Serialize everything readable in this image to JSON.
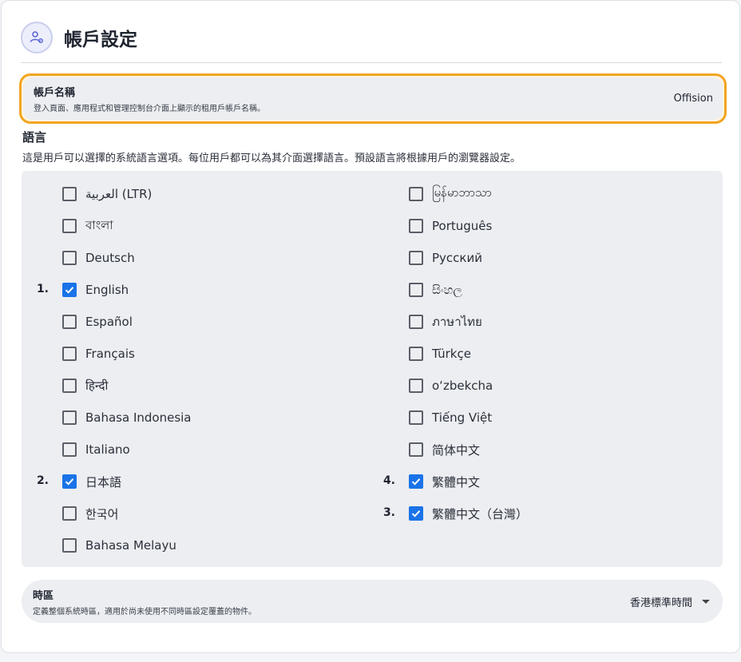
{
  "header": {
    "title": "帳戶設定",
    "icon": "user-gear-icon"
  },
  "account_name": {
    "title": "帳戶名稱",
    "description": "登入頁面、應用程式和管理控制台介面上顯示的租用戶帳戶名稱。",
    "value": "Offision"
  },
  "language": {
    "title": "語言",
    "description": "這是用戶可以選擇的系統語言選項。每位用戶都可以為其介面選擇語言。預設語言將根據用戶的瀏覽器設定。",
    "left": [
      {
        "label": "العربية (LTR)",
        "checked": false,
        "order": ""
      },
      {
        "label": "বাংলা",
        "checked": false,
        "order": ""
      },
      {
        "label": "Deutsch",
        "checked": false,
        "order": ""
      },
      {
        "label": "English",
        "checked": true,
        "order": "1."
      },
      {
        "label": "Español",
        "checked": false,
        "order": ""
      },
      {
        "label": "Français",
        "checked": false,
        "order": ""
      },
      {
        "label": "हिन्दी",
        "checked": false,
        "order": ""
      },
      {
        "label": "Bahasa Indonesia",
        "checked": false,
        "order": ""
      },
      {
        "label": "Italiano",
        "checked": false,
        "order": ""
      },
      {
        "label": "日本語",
        "checked": true,
        "order": "2."
      },
      {
        "label": "한국어",
        "checked": false,
        "order": ""
      },
      {
        "label": "Bahasa Melayu",
        "checked": false,
        "order": ""
      }
    ],
    "right": [
      {
        "label": "မြန်မာဘာသာ",
        "checked": false,
        "order": ""
      },
      {
        "label": "Português",
        "checked": false,
        "order": ""
      },
      {
        "label": "Русский",
        "checked": false,
        "order": ""
      },
      {
        "label": "සිංහල",
        "checked": false,
        "order": ""
      },
      {
        "label": "ภาษาไทย",
        "checked": false,
        "order": ""
      },
      {
        "label": "Türkçe",
        "checked": false,
        "order": ""
      },
      {
        "label": "oʻzbekcha",
        "checked": false,
        "order": ""
      },
      {
        "label": "Tiếng Việt",
        "checked": false,
        "order": ""
      },
      {
        "label": "简体中文",
        "checked": false,
        "order": ""
      },
      {
        "label": "繁體中文",
        "checked": true,
        "order": "4."
      },
      {
        "label": "繁體中文（台灣）",
        "checked": true,
        "order": "3."
      }
    ]
  },
  "timezone": {
    "title": "時區",
    "description": "定義整個系統時區，適用於尚未使用不同時區設定覆蓋的物件。",
    "value": "香港標準時間",
    "dropdown_icon": "caret-down-icon"
  },
  "colors": {
    "accent": "#1a73e8",
    "highlight": "#f2a51f",
    "row_bg": "#eceef1"
  }
}
